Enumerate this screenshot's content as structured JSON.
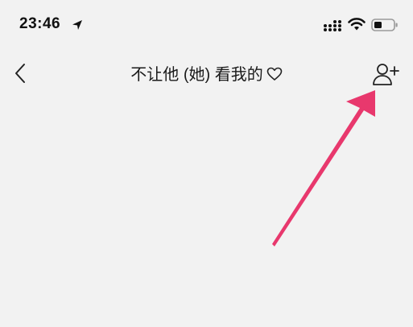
{
  "status_bar": {
    "time": "23:46",
    "location_icon": "location-arrow-icon",
    "signal_icon": "cellular-signal-icon",
    "wifi_icon": "wifi-icon",
    "battery_icon": "battery-icon"
  },
  "nav_bar": {
    "back_icon": "chevron-left-icon",
    "title": "不让他 (她) 看我的",
    "title_icon": "heart-outline-icon",
    "add_icon": "add-user-icon"
  },
  "annotation": {
    "arrow_color": "#e8386d"
  },
  "colors": {
    "background": "#f2f2f2",
    "text": "#1a1a1a"
  }
}
